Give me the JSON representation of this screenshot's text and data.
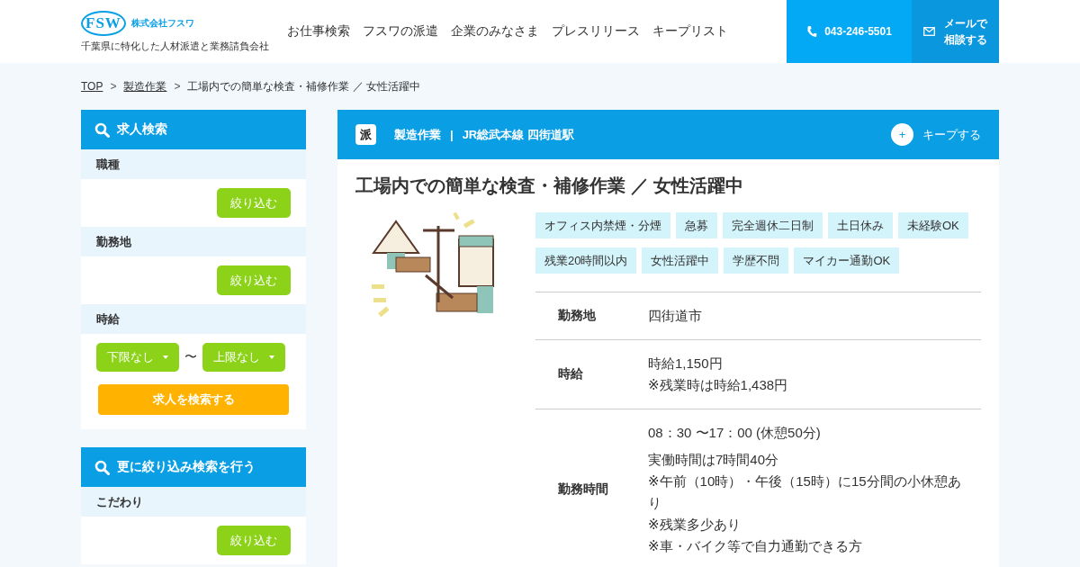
{
  "header": {
    "logo": {
      "mark": "FSW",
      "company": "株式会社フスワ",
      "tagline": "千葉県に特化した人材派遣と業務請負会社"
    },
    "nav": [
      "お仕事検索",
      "フスワの派遣",
      "企業のみなさま",
      "プレスリリース",
      "キープリスト"
    ],
    "phone": "043-246-5501",
    "mail_button": [
      "メールで",
      "相談する"
    ]
  },
  "breadcrumb": [
    {
      "label": "TOP",
      "link": true
    },
    {
      "separator": ">",
      "label": "製造作業",
      "link": true
    },
    {
      "separator": ">",
      "label": "工場内での簡単な検査・補修作業 ／ 女性活躍中",
      "link": false
    }
  ],
  "sidebar": {
    "panels": [
      {
        "title": "求人検索",
        "sections": [
          {
            "label": "職種",
            "kind": "filter",
            "button": "絞り込む"
          },
          {
            "label": "勤務地",
            "kind": "filter",
            "button": "絞り込む"
          },
          {
            "label": "時給",
            "kind": "range",
            "min": "下限なし",
            "separator": "〜",
            "max": "上限なし",
            "button": "求人を検索する"
          }
        ]
      },
      {
        "title": "更に絞り込み検索を行う",
        "sections": [
          {
            "label": "こだわり",
            "kind": "filter",
            "button": "絞り込む"
          }
        ]
      }
    ]
  },
  "job": {
    "badge": "派",
    "category": "製造作業",
    "divider": "|",
    "station": "JR総武本線 四街道駅",
    "keep_icon": "+",
    "keep": "キープする",
    "title": "工場内での簡単な検査・補修作業 ／ 女性活躍中",
    "tags": [
      "オフィス内禁煙・分煙",
      "急募",
      "完全週休二日制",
      "土日休み",
      "未経験OK",
      "残業20時間以内",
      "女性活躍中",
      "学歴不問",
      "マイカー通勤OK"
    ],
    "details": [
      {
        "label": "勤務地",
        "paragraphs": [
          [
            "四街道市"
          ]
        ]
      },
      {
        "label": "時給",
        "paragraphs": [
          [
            "時給1,150円",
            " ※残業時は時給1,438円"
          ]
        ]
      },
      {
        "label": "勤務時間",
        "paragraphs": [
          [
            "08：30 〜17：00 (休憩50分)"
          ],
          [
            "実働時間は7時間40分",
            "※午前（10時）・午後（15時）に15分間の小休憩あり",
            "※残業多少あり",
            "※車・バイク等で自力通勤できる方"
          ]
        ]
      }
    ]
  }
}
